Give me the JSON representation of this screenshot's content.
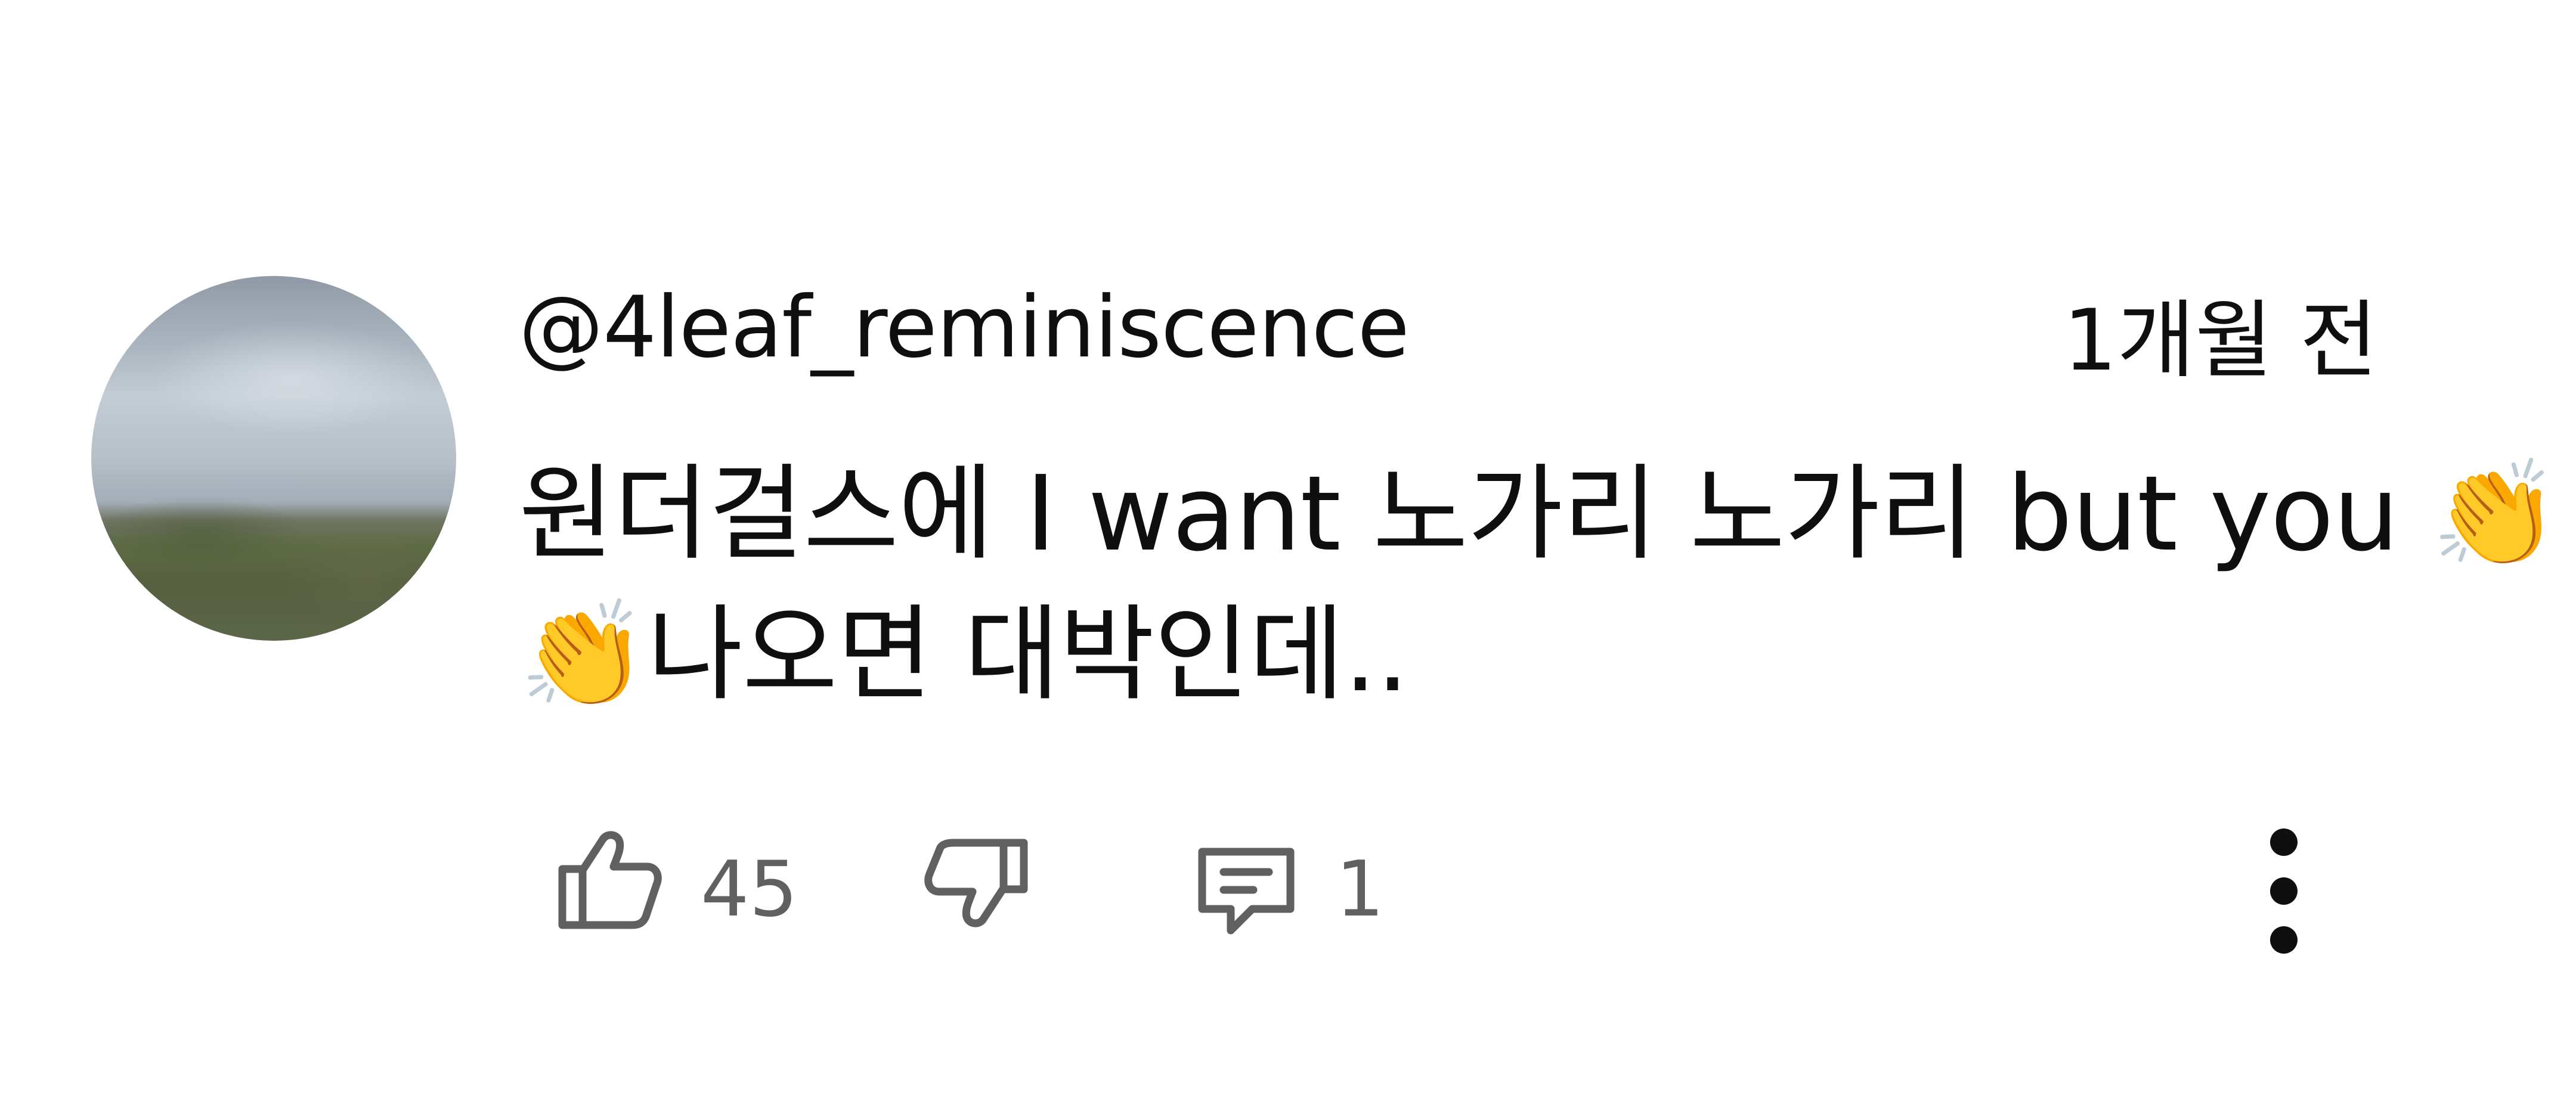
{
  "comment": {
    "author": "@4leaf_reminiscence",
    "timestamp": "1개월 전",
    "text_line1": "원더걸스에 I want 노가리 노가리 but you 👏",
    "text_line2": "👏나오면 대박인데..",
    "avatar_icon": "avatar-landscape-photo",
    "like_icon": "thumbs-up-icon",
    "like_count": "45",
    "dislike_icon": "thumbs-down-icon",
    "reply_icon": "comment-bubble-icon",
    "reply_count": "1",
    "more_icon": "more-vertical-icon",
    "colors": {
      "text": "#0f0f0f",
      "secondary_text": "#606060",
      "icon_stroke": "#606060",
      "background": "#ffffff"
    }
  }
}
